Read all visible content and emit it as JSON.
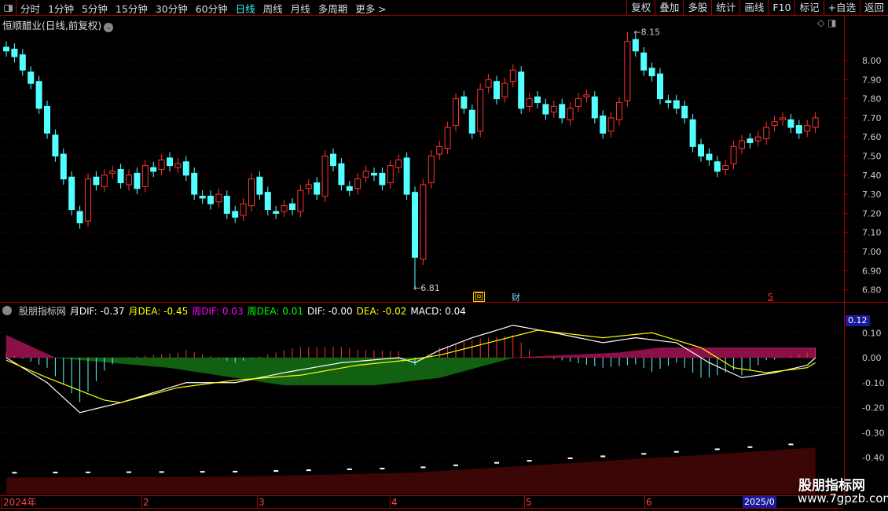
{
  "toolbar": {
    "periods": [
      "分时",
      "1分钟",
      "5分钟",
      "15分钟",
      "30分钟",
      "60分钟",
      "日线",
      "周线",
      "月线",
      "多周期",
      "更多 >"
    ],
    "active": "日线",
    "actions": [
      "复权",
      "叠加",
      "多股",
      "统计",
      "画线",
      "F10",
      "标记",
      "+自选",
      "返回"
    ]
  },
  "stock": {
    "title": "恒顺醋业(日线,前复权)"
  },
  "price_axis": [
    "8.00",
    "7.90",
    "7.80",
    "7.70",
    "7.60",
    "7.50",
    "7.40",
    "7.30",
    "7.20",
    "7.10",
    "7.00",
    "6.90",
    "6.80"
  ],
  "annotations": {
    "high": "8.15",
    "low": "6.81",
    "marker_hui": "回",
    "marker_cai": "财",
    "marker_s": "S"
  },
  "indicator": {
    "name": "股朋指标网",
    "items": [
      {
        "label": "月DIF: -0.37",
        "color": "#ffffff"
      },
      {
        "label": "月DEA: -0.45",
        "color": "#ffff00"
      },
      {
        "label": "周DIF: 0.03",
        "color": "#ff00ff"
      },
      {
        "label": "周DEA: 0.01",
        "color": "#00ff00"
      },
      {
        "label": "DIF: -0.00",
        "color": "#ffffff"
      },
      {
        "label": "DEA: -0.02",
        "color": "#ffff00"
      },
      {
        "label": "MACD: 0.04",
        "color": "#ffffff"
      }
    ],
    "axis": [
      "0.10",
      "0.00",
      "-0.10",
      "-0.20",
      "-0.30",
      "-0.40"
    ],
    "current": "0.12"
  },
  "x_axis": {
    "labels": [
      "2024年",
      "2",
      "3",
      "4",
      "5",
      "6"
    ],
    "date_box": "2025/0"
  },
  "watermark": {
    "line1": "股朋指标网",
    "line2": "www.7gpzb.com"
  },
  "chart_data": {
    "type": "candlestick",
    "closes": [
      8.05,
      8.02,
      7.95,
      7.88,
      7.75,
      7.62,
      7.5,
      7.38,
      7.22,
      7.15,
      7.38,
      7.35,
      7.4,
      7.42,
      7.36,
      7.4,
      7.33,
      7.45,
      7.42,
      7.48,
      7.45,
      7.46,
      7.4,
      7.3,
      7.28,
      7.25,
      7.3,
      7.2,
      7.18,
      7.25,
      7.38,
      7.3,
      7.22,
      7.2,
      7.24,
      7.22,
      7.32,
      7.35,
      7.3,
      7.5,
      7.45,
      7.35,
      7.32,
      7.38,
      7.42,
      7.4,
      7.35,
      7.45,
      7.48,
      7.3,
      6.97,
      7.35,
      7.5,
      7.55,
      7.65,
      7.8,
      7.75,
      7.62,
      7.85,
      7.9,
      7.8,
      7.88,
      7.95,
      7.75,
      7.8,
      7.78,
      7.72,
      7.76,
      7.7,
      7.75,
      7.8,
      7.82,
      7.7,
      7.62,
      7.7,
      7.78,
      8.1,
      8.05,
      7.95,
      7.92,
      7.8,
      7.78,
      7.75,
      7.7,
      7.55,
      7.5,
      7.48,
      7.42,
      7.45,
      7.55,
      7.58,
      7.57,
      7.6,
      7.65,
      7.68,
      7.7,
      7.65,
      7.62,
      7.66,
      7.7
    ],
    "price_range": [
      6.78,
      8.2
    ],
    "dif": [
      [
        0,
        0
      ],
      [
        5,
        -0.1
      ],
      [
        9,
        -0.22
      ],
      [
        14,
        -0.18
      ],
      [
        22,
        -0.1
      ],
      [
        28,
        -0.1
      ],
      [
        34,
        -0.06
      ],
      [
        41,
        -0.02
      ],
      [
        48,
        0
      ],
      [
        50,
        -0.02
      ],
      [
        53,
        0.03
      ],
      [
        57,
        0.08
      ],
      [
        62,
        0.13
      ],
      [
        67,
        0.1
      ],
      [
        73,
        0.06
      ],
      [
        77,
        0.08
      ],
      [
        82,
        0.06
      ],
      [
        86,
        -0.02
      ],
      [
        90,
        -0.08
      ],
      [
        94,
        -0.06
      ],
      [
        98,
        -0.03
      ],
      [
        99,
        0
      ]
    ],
    "dea": [
      [
        0,
        -0.01
      ],
      [
        5,
        -0.08
      ],
      [
        12,
        -0.17
      ],
      [
        14,
        -0.18
      ],
      [
        21,
        -0.12
      ],
      [
        28,
        -0.09
      ],
      [
        36,
        -0.07
      ],
      [
        43,
        -0.03
      ],
      [
        49,
        -0.01
      ],
      [
        53,
        0.01
      ],
      [
        59,
        0.06
      ],
      [
        65,
        0.11
      ],
      [
        73,
        0.08
      ],
      [
        79,
        0.1
      ],
      [
        85,
        0.04
      ],
      [
        89,
        -0.04
      ],
      [
        93,
        -0.06
      ],
      [
        98,
        -0.04
      ],
      [
        99,
        -0.02
      ]
    ],
    "band": [
      [
        0,
        0.09
      ],
      [
        6,
        0
      ],
      [
        20,
        -0.04
      ],
      [
        34,
        -0.11
      ],
      [
        45,
        -0.11
      ],
      [
        53,
        -0.08
      ],
      [
        62,
        0
      ],
      [
        75,
        0.02
      ],
      [
        80,
        0.04
      ],
      [
        99,
        0.04
      ]
    ],
    "monthly": [
      [
        0,
        -0.48
      ],
      [
        30,
        -0.475
      ],
      [
        50,
        -0.46
      ],
      [
        70,
        -0.42
      ],
      [
        85,
        -0.39
      ],
      [
        99,
        -0.36
      ]
    ]
  }
}
